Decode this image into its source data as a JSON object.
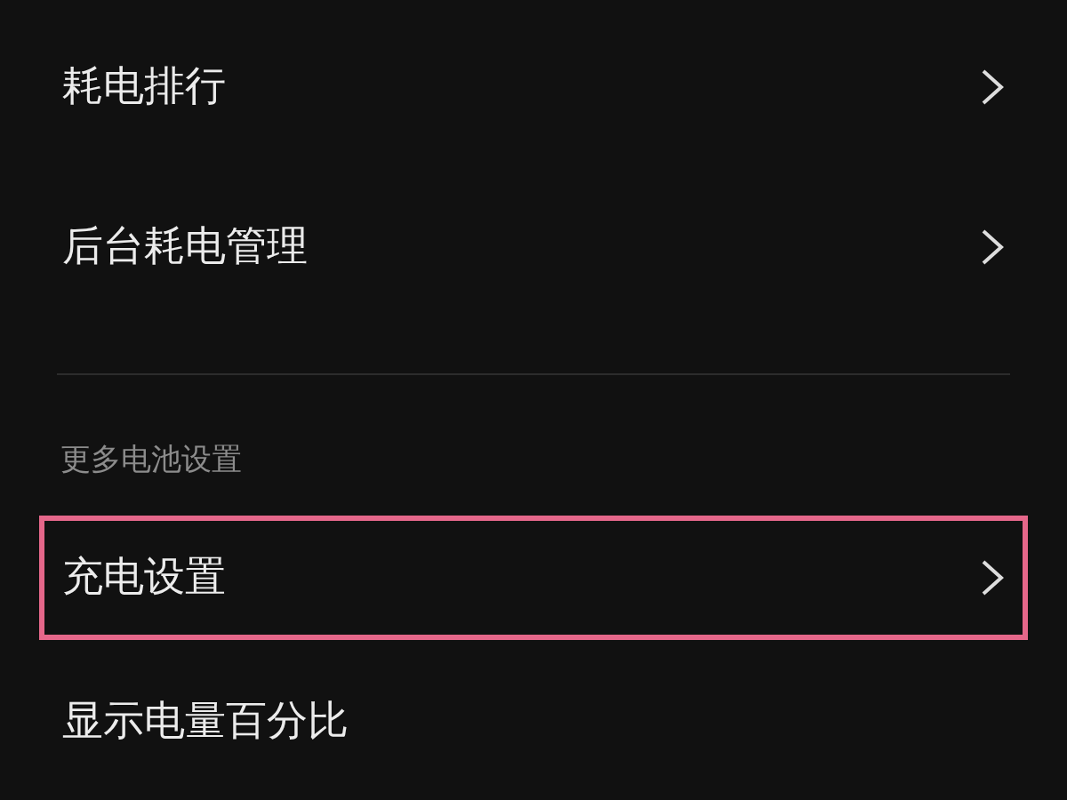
{
  "groups": [
    {
      "items": [
        {
          "label": "耗电排行",
          "chevron": true,
          "highlighted": false
        },
        {
          "label": "后台耗电管理",
          "chevron": true,
          "highlighted": false
        }
      ]
    },
    {
      "header": "更多电池设置",
      "items": [
        {
          "label": "充电设置",
          "chevron": true,
          "highlighted": true
        },
        {
          "label": "显示电量百分比",
          "chevron": false,
          "highlighted": false
        }
      ]
    }
  ]
}
